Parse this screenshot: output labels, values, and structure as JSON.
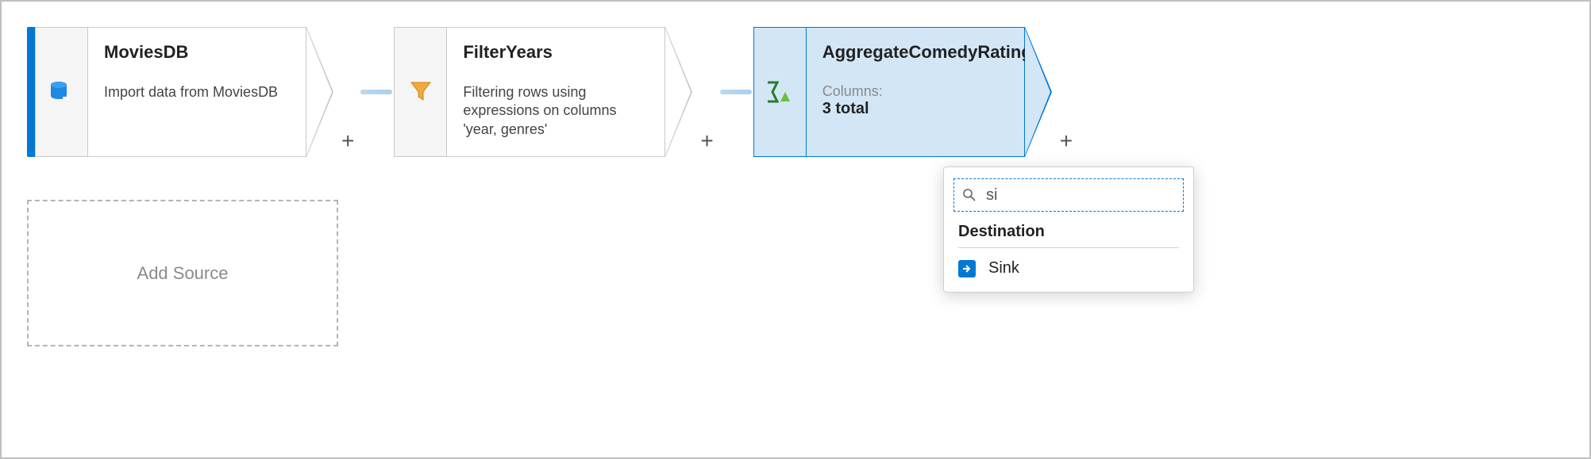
{
  "nodes": {
    "source": {
      "title": "MoviesDB",
      "desc": "Import data from MoviesDB"
    },
    "filter": {
      "title": "FilterYears",
      "desc": "Filtering rows using expressions on columns 'year, genres'"
    },
    "aggregate": {
      "title": "AggregateComedyRating",
      "cols_label": "Columns:",
      "cols_value": "3 total"
    }
  },
  "add_source_label": "Add Source",
  "popover": {
    "search_value": "si",
    "heading": "Destination",
    "item_sink": "Sink"
  },
  "plus": "+"
}
